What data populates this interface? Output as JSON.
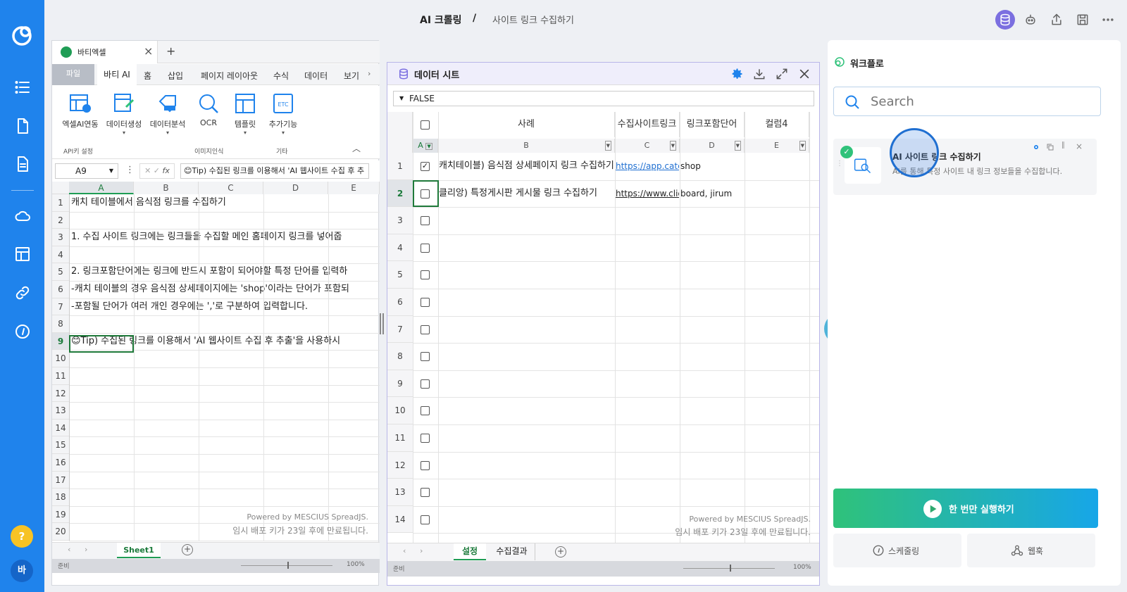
{
  "header": {
    "title": "AI 크롤링",
    "separator": "/",
    "subtitle": "사이트 링크 수집하기"
  },
  "left_nav": {
    "help_label": "?",
    "avatar_label": "바"
  },
  "excel": {
    "tab_title": "바티엑셀",
    "menu": [
      "파일",
      "바티 AI",
      "홈",
      "삽입",
      "페이지 레이아웃",
      "수식",
      "데이터",
      "보기"
    ],
    "ribbon": {
      "excel_ai": "엑셀AI연동",
      "data_gen": "데이터생성",
      "data_analysis": "데이터분석",
      "ocr": "OCR",
      "template": "템플릿",
      "extra": "추가기능",
      "group_api": "API키 설정",
      "group_image": "이미지인식",
      "group_etc": "기타"
    },
    "name_box": "A9",
    "formula": "😊Tip) 수집된 링크를 이용해서 'AI 웹사이트 수집 후 추",
    "columns": [
      "A",
      "B",
      "C",
      "D",
      "E"
    ],
    "rows": [
      {
        "n": "1",
        "text": "캐치 테이블에서 음식점 링크를 수집하기"
      },
      {
        "n": "2",
        "text": ""
      },
      {
        "n": "3",
        "text": "1. 수집 사이트 링크에는 링크들을 수집할 메인 홈페이지 링크를 넣어줍"
      },
      {
        "n": "4",
        "text": ""
      },
      {
        "n": "5",
        "text": "2. 링크포함단어에는 링크에 반드시 포함이 되어야할 특정 단어를 입력하"
      },
      {
        "n": "6",
        "text": "-캐치 테이블의 경우 음식점 상세페이지에는 'shop'이라는 단어가 포함되"
      },
      {
        "n": "7",
        "text": "-포함될 단어가 여러 개인 경우에는 ','로 구분하여 입력합니다."
      },
      {
        "n": "8",
        "text": ""
      },
      {
        "n": "9",
        "text": "😊Tip) 수집된 링크를 이용해서 'AI 웹사이트 수집 후 추출'을 사용하시"
      },
      {
        "n": "10",
        "text": ""
      },
      {
        "n": "11",
        "text": ""
      },
      {
        "n": "12",
        "text": ""
      },
      {
        "n": "13",
        "text": ""
      },
      {
        "n": "14",
        "text": ""
      },
      {
        "n": "15",
        "text": ""
      },
      {
        "n": "16",
        "text": ""
      },
      {
        "n": "17",
        "text": ""
      },
      {
        "n": "18",
        "text": ""
      },
      {
        "n": "19",
        "text": ""
      },
      {
        "n": "20",
        "text": ""
      }
    ],
    "watermark1": "Powered by MESCIUS SpreadJS.",
    "watermark2": "임시 배포 키가 23일 후에 만료됩니다.",
    "sheet_tab": "Sheet1",
    "status": "준비",
    "zoom": "100%"
  },
  "datasheet": {
    "title": "데이터 시트",
    "filter_value": "FALSE",
    "headers": [
      "사례",
      "수집사이트링크",
      "링크포함단어",
      "컬럼4"
    ],
    "cols": [
      "A",
      "B",
      "C",
      "D",
      "E"
    ],
    "rows": [
      {
        "n": "1",
        "checked": true,
        "case": "캐치테이블) 음식점 상세페이지 링크 수집하기",
        "link": "https://app.catchtable",
        "word": "shop"
      },
      {
        "n": "2",
        "checked": false,
        "case": "클리앙) 특정게시판 게시물 링크 수집하기",
        "link": "https://www.clien.net",
        "word": "board, jirum"
      },
      {
        "n": "3",
        "checked": false,
        "case": "",
        "link": "",
        "word": ""
      },
      {
        "n": "4",
        "checked": false,
        "case": "",
        "link": "",
        "word": ""
      },
      {
        "n": "5",
        "checked": false,
        "case": "",
        "link": "",
        "word": ""
      },
      {
        "n": "6",
        "checked": false,
        "case": "",
        "link": "",
        "word": ""
      },
      {
        "n": "7",
        "checked": false,
        "case": "",
        "link": "",
        "word": ""
      },
      {
        "n": "8",
        "checked": false,
        "case": "",
        "link": "",
        "word": ""
      },
      {
        "n": "9",
        "checked": false,
        "case": "",
        "link": "",
        "word": ""
      },
      {
        "n": "10",
        "checked": false,
        "case": "",
        "link": "",
        "word": ""
      },
      {
        "n": "11",
        "checked": false,
        "case": "",
        "link": "",
        "word": ""
      },
      {
        "n": "12",
        "checked": false,
        "case": "",
        "link": "",
        "word": ""
      },
      {
        "n": "13",
        "checked": false,
        "case": "",
        "link": "",
        "word": ""
      },
      {
        "n": "14",
        "checked": false,
        "case": "",
        "link": "",
        "word": ""
      }
    ],
    "watermark1": "Powered by MESCIUS SpreadJS.",
    "watermark2": "임시 배포 키가 23일 후에 만료됩니다.",
    "tab_settings": "설정",
    "tab_results": "수집결과",
    "status": "준비",
    "zoom": "100%"
  },
  "workflow": {
    "title": "워크플로",
    "search_placeholder": "Search",
    "card_title": "AI 사이트 링크 수집하기",
    "card_desc": "AI를 통해 특정 사이트 내 링크 정보들을 수집합니다.",
    "run_once": "한 번만 실행하기",
    "schedule": "스케줄링",
    "webhook": "웹훅"
  },
  "colors": {
    "nav_blue": "#1f83ec",
    "run_gradient_start": "#2fc27a",
    "run_gradient_end": "#17a6e8",
    "accent_purple": "#7b6fe0"
  }
}
